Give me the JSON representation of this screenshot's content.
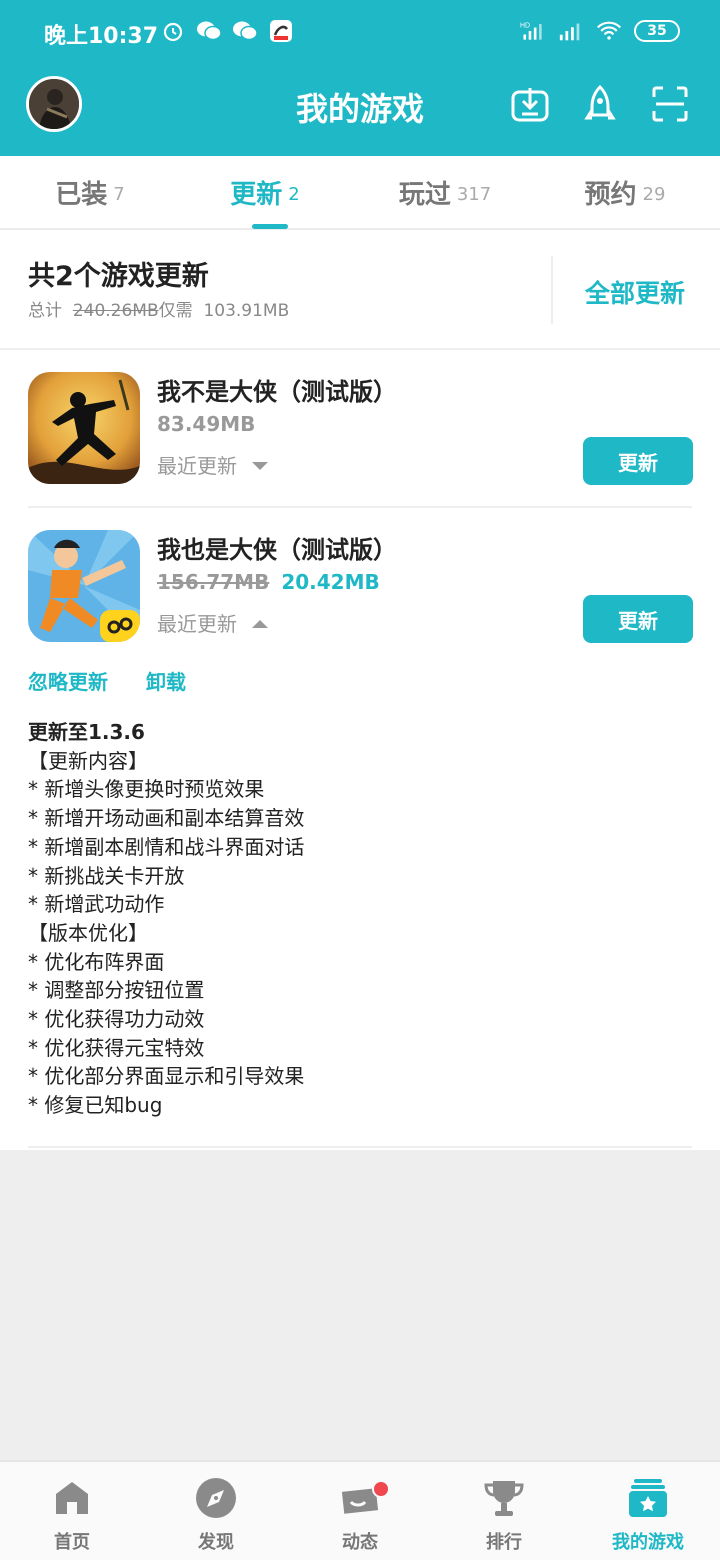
{
  "status_bar": {
    "time": "晚上10:37",
    "battery": "35",
    "network": "HD"
  },
  "header": {
    "title": "我的游戏",
    "icons": [
      "download-icon",
      "rocket-icon",
      "scan-icon"
    ]
  },
  "tabs": [
    {
      "label": "已装",
      "count": "7"
    },
    {
      "label": "更新",
      "count": "2"
    },
    {
      "label": "玩过",
      "count": "317"
    },
    {
      "label": "预约",
      "count": "29"
    }
  ],
  "active_tab": "更新",
  "summary": {
    "title": "共2个游戏更新",
    "total_prefix": "总计",
    "total_original": "240.26MB",
    "only_need_label": "仅需",
    "total_needed": "103.91MB",
    "update_all": "全部更新"
  },
  "games": [
    {
      "name": "我不是大侠（测试版）",
      "size": "83.49MB",
      "recent_label": "最近更新",
      "button": "更新"
    },
    {
      "name": "我也是大侠（测试版）",
      "size_old": "156.77MB",
      "size_new": "20.42MB",
      "recent_label": "最近更新",
      "button": "更新",
      "ignore": "忽略更新",
      "uninstall": "卸载",
      "notes": {
        "version": "更新至1.3.6",
        "lines": [
          "【更新内容】",
          "* 新增头像更换时预览效果",
          "* 新增开场动画和副本结算音效",
          "* 新增副本剧情和战斗界面对话",
          "* 新挑战关卡开放",
          "* 新增武功动作",
          "【版本优化】",
          "* 优化布阵界面",
          "* 调整部分按钮位置",
          "* 优化获得功力动效",
          "* 优化获得元宝特效",
          "* 优化部分界面显示和引导效果",
          "* 修复已知bug"
        ]
      }
    }
  ],
  "bottom_nav": [
    {
      "label": "首页",
      "icon": "home-icon"
    },
    {
      "label": "发现",
      "icon": "compass-icon"
    },
    {
      "label": "动态",
      "icon": "feed-icon"
    },
    {
      "label": "排行",
      "icon": "trophy-icon"
    },
    {
      "label": "我的游戏",
      "icon": "my-games-icon"
    }
  ],
  "colors": {
    "accent": "#1fb8c6",
    "badge": "#f0484f"
  }
}
